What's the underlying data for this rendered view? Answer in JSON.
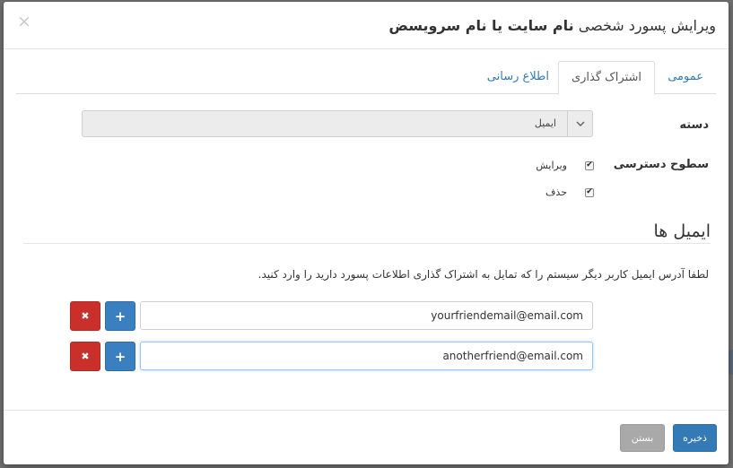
{
  "header": {
    "close_glyph": "×",
    "title_prefix": "ویرایش پسورد شخصی",
    "title_bold": "نام سایت یا نام سرویسض"
  },
  "tabs": [
    {
      "label": "عمومی",
      "active": false
    },
    {
      "label": "اشتراک گذاری",
      "active": true
    },
    {
      "label": "اطلاع رسانی",
      "active": false
    }
  ],
  "form": {
    "category_label": "دسته",
    "category_value": "ایمیل",
    "access_label": "سطوح دسترسی",
    "permissions": [
      {
        "label": "ویرایش",
        "checked": true
      },
      {
        "label": "حذف",
        "checked": true
      }
    ]
  },
  "emails_section": {
    "title": "ایمیل ها",
    "help_text": "لطفا آدرس ایمیل کاربر دیگر سیستم را که تمایل به اشتراک گذاری اطلاعات پسورد دارید را وارد کنید.",
    "rows": [
      {
        "value": "yourfriendemail@email.com"
      },
      {
        "value": "anotherfriend@email.com"
      }
    ],
    "remove_glyph": "✖",
    "add_glyph": "+"
  },
  "footer": {
    "close_label": "بستن",
    "save_label": "ذخیره"
  },
  "colors": {
    "primary": "#337ab7",
    "danger": "#c9302c",
    "default": "#a9a9a9"
  }
}
